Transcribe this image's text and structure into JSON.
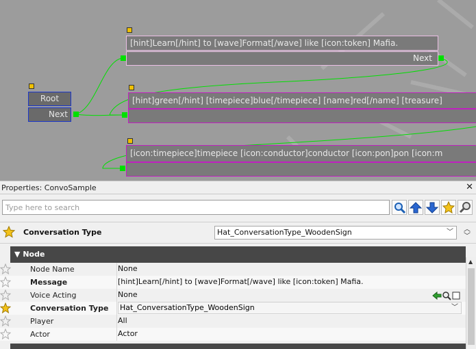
{
  "graph": {
    "root_label": "Root",
    "root_next": "Next",
    "nodes": [
      {
        "text": "[hint]Learn[/hint] to [wave]Format[/wave] like [icon:token] Mafia.",
        "next": "Next"
      },
      {
        "text": "[hint]green[/hint] [timepiece]blue[/timepiece] [name]red[/name] [treasure]",
        "next": ""
      },
      {
        "text": "[icon:timepiece]timepiece [icon:conductor]conductor [icon:pon]pon [icon:m",
        "next": ""
      }
    ]
  },
  "properties": {
    "title": "Properties: ConvoSample",
    "close": "✕",
    "search_placeholder": "Type here to search",
    "conversation_type_label": "Conversation Type",
    "conversation_type_value": "Hat_ConversationType_WoodenSign",
    "section_title": "Node",
    "rows": [
      {
        "name": "Node Name",
        "value": "None",
        "bold": false
      },
      {
        "name": "Message",
        "value": "[hint]Learn[/hint] to [wave]Format[/wave] like [icon:token] Mafia.",
        "bold": true
      },
      {
        "name": "Voice Acting",
        "value": "None",
        "bold": false
      },
      {
        "name": "Conversation Type",
        "value": "Hat_ConversationType_WoodenSign",
        "bold": true
      },
      {
        "name": "Player",
        "value": "All",
        "bold": false
      },
      {
        "name": "Actor",
        "value": "Actor",
        "bold": false
      }
    ]
  },
  "colors": {
    "graph_bg": "#9c9c9c",
    "link_green": "#00e000",
    "node_border_pink": "#ecbfe6",
    "node_border_magenta": "#c020c0",
    "root_border": "#1b36c9",
    "section_header": "#474747"
  }
}
